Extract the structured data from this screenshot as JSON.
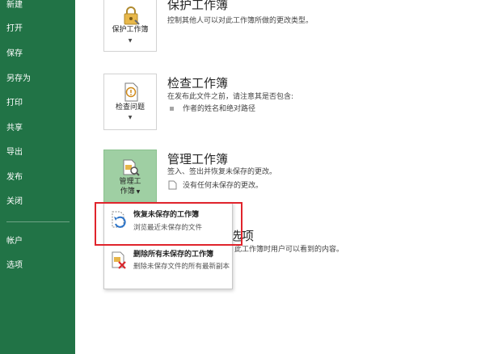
{
  "sidebar": {
    "items": [
      {
        "label": "新建"
      },
      {
        "label": "打开"
      },
      {
        "label": "保存"
      },
      {
        "label": "另存为"
      },
      {
        "label": "打印"
      },
      {
        "label": "共享"
      },
      {
        "label": "导出"
      },
      {
        "label": "发布"
      },
      {
        "label": "关闭"
      },
      {
        "label": "帐户"
      },
      {
        "label": "选项"
      }
    ]
  },
  "sections": {
    "protect": {
      "tile_label": "保护工作簿",
      "title": "保护工作簿",
      "desc": "控制其他人可以对此工作簿所做的更改类型。"
    },
    "inspect": {
      "tile_label": "检查问题",
      "title": "检查工作簿",
      "desc": "在发布此文件之前，请注意其是否包含:",
      "bullet": "作者的姓名和绝对路径"
    },
    "manage": {
      "tile_label_line1": "管理工",
      "tile_label_line2": "作簿",
      "title": "管理工作簿",
      "desc": "签入、签出并恢复未保存的更改。",
      "sub": "没有任何未保存的更改。"
    },
    "hidden": {
      "title_fragment": "选项",
      "desc_fragment": "此工作簿时用户可以看到的内容。"
    }
  },
  "dropdown": {
    "items": [
      {
        "title": "恢复未保存的工作簿",
        "desc": "浏览最近未保存的文件"
      },
      {
        "title": "删除所有未保存的工作簿",
        "desc": "删除未保存文件的所有最新副本"
      }
    ]
  },
  "colors": {
    "sidebar_bg": "#217346",
    "active_tile_bg": "#9fcfa3",
    "highlight": "#e0242c"
  }
}
